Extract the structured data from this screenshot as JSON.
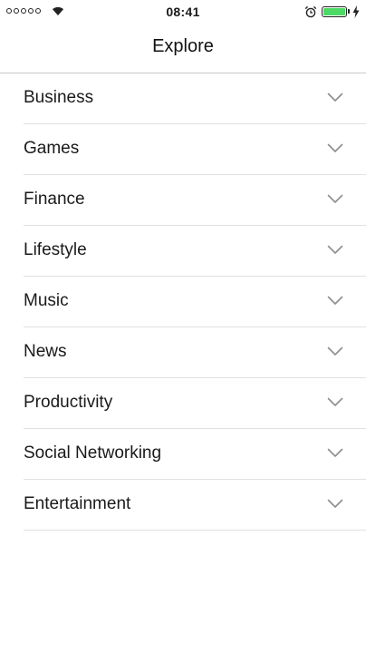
{
  "status_bar": {
    "time": "08:41",
    "signal_icon": "signal-dots-icon",
    "wifi_icon": "wifi-icon",
    "alarm_icon": "alarm-clock-icon",
    "battery_icon": "battery-icon",
    "charging_icon": "charging-bolt-icon",
    "battery_level": 1.0,
    "battery_color": "#4cd964"
  },
  "nav": {
    "title": "Explore"
  },
  "categories": {
    "chevron_icon": "chevron-down-icon",
    "items": [
      {
        "label": "Business"
      },
      {
        "label": "Games"
      },
      {
        "label": "Finance"
      },
      {
        "label": "Lifestyle"
      },
      {
        "label": "Music"
      },
      {
        "label": "News"
      },
      {
        "label": "Productivity"
      },
      {
        "label": "Social Networking"
      },
      {
        "label": "Entertainment"
      }
    ]
  }
}
